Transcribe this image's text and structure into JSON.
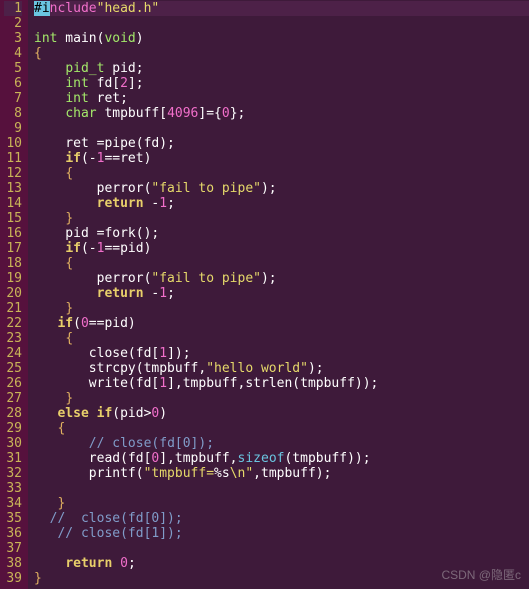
{
  "watermark": "CSDN @隐匿c",
  "lines": [
    {
      "n": 1,
      "html": "<span class='cursor-highlight'>#i</span><span class='k-inc'>nclude</span><span class='k-str'>\"head.h\"</span>"
    },
    {
      "n": 2,
      "html": ""
    },
    {
      "n": 3,
      "html": "<span class='k-type'>int</span> main(<span class='k-type'>void</span>)"
    },
    {
      "n": 4,
      "html": "<span class='k-punc'>{</span>"
    },
    {
      "n": 5,
      "html": "    <span class='k-type'>pid_t</span> pid;"
    },
    {
      "n": 6,
      "html": "    <span class='k-type'>int</span> fd[<span class='k-num'>2</span>];"
    },
    {
      "n": 7,
      "html": "    <span class='k-type'>int</span> ret;"
    },
    {
      "n": 8,
      "html": "    <span class='k-type'>char</span> tmpbuff[<span class='k-num'>4096</span>]={<span class='k-num'>0</span>};"
    },
    {
      "n": 9,
      "html": ""
    },
    {
      "n": 10,
      "html": "    ret =pipe(fd);"
    },
    {
      "n": 11,
      "html": "    <span class='k-flow'>if</span>(-<span class='k-num'>1</span>==ret)"
    },
    {
      "n": 12,
      "html": "    <span class='k-punc'>{</span>"
    },
    {
      "n": 13,
      "html": "        perror(<span class='k-str'>\"fail to pipe\"</span>);"
    },
    {
      "n": 14,
      "html": "        <span class='k-flow'>return</span> -<span class='k-num'>1</span>;"
    },
    {
      "n": 15,
      "html": "    <span class='k-punc'>}</span>"
    },
    {
      "n": 16,
      "html": "    pid =fork();"
    },
    {
      "n": 17,
      "html": "    <span class='k-flow'>if</span>(-<span class='k-num'>1</span>==pid)"
    },
    {
      "n": 18,
      "html": "    <span class='k-punc'>{</span>"
    },
    {
      "n": 19,
      "html": "        perror(<span class='k-str'>\"fail to pipe\"</span>);"
    },
    {
      "n": 20,
      "html": "        <span class='k-flow'>return</span> -<span class='k-num'>1</span>;"
    },
    {
      "n": 21,
      "html": "    <span class='k-punc'>}</span>"
    },
    {
      "n": 22,
      "html": "   <span class='k-flow'>if</span>(<span class='k-num'>0</span>==pid)"
    },
    {
      "n": 23,
      "html": "    <span class='k-punc'>{</span>"
    },
    {
      "n": 24,
      "html": "       close(fd[<span class='k-num'>1</span>]);"
    },
    {
      "n": 25,
      "html": "       strcpy(tmpbuff,<span class='k-str'>\"hello world\"</span>);"
    },
    {
      "n": 26,
      "html": "       write(fd[<span class='k-num'>1</span>],tmpbuff,strlen(tmpbuff));"
    },
    {
      "n": 27,
      "html": "    <span class='k-punc'>}</span>"
    },
    {
      "n": 28,
      "html": "   <span class='k-flow'>else</span> <span class='k-flow'>if</span>(pid&gt;<span class='k-num'>0</span>)"
    },
    {
      "n": 29,
      "html": "   <span class='k-punc'>{</span>"
    },
    {
      "n": 30,
      "html": "       <span class='k-cmt'>// close(fd[0]);</span>"
    },
    {
      "n": 31,
      "html": "       read(fd[<span class='k-num'>0</span>],tmpbuff,<span class='k-builtin'>sizeof</span>(tmpbuff));"
    },
    {
      "n": 32,
      "html": "       printf(<span class='k-str'>\"tmpbuff=</span>%s<span class='k-str'>\\n\"</span>,tmpbuff);"
    },
    {
      "n": 33,
      "html": ""
    },
    {
      "n": 34,
      "html": "   <span class='k-punc'>}</span>"
    },
    {
      "n": 35,
      "html": "  <span class='k-cmt'>//  close(fd[0]);</span>"
    },
    {
      "n": 36,
      "html": "   <span class='k-cmt'>// close(fd[1]);</span>"
    },
    {
      "n": 37,
      "html": ""
    },
    {
      "n": 38,
      "html": "    <span class='k-flow'>return</span> <span class='k-num'>0</span>;"
    },
    {
      "n": 39,
      "html": "<span class='k-punc'>}</span>"
    }
  ]
}
